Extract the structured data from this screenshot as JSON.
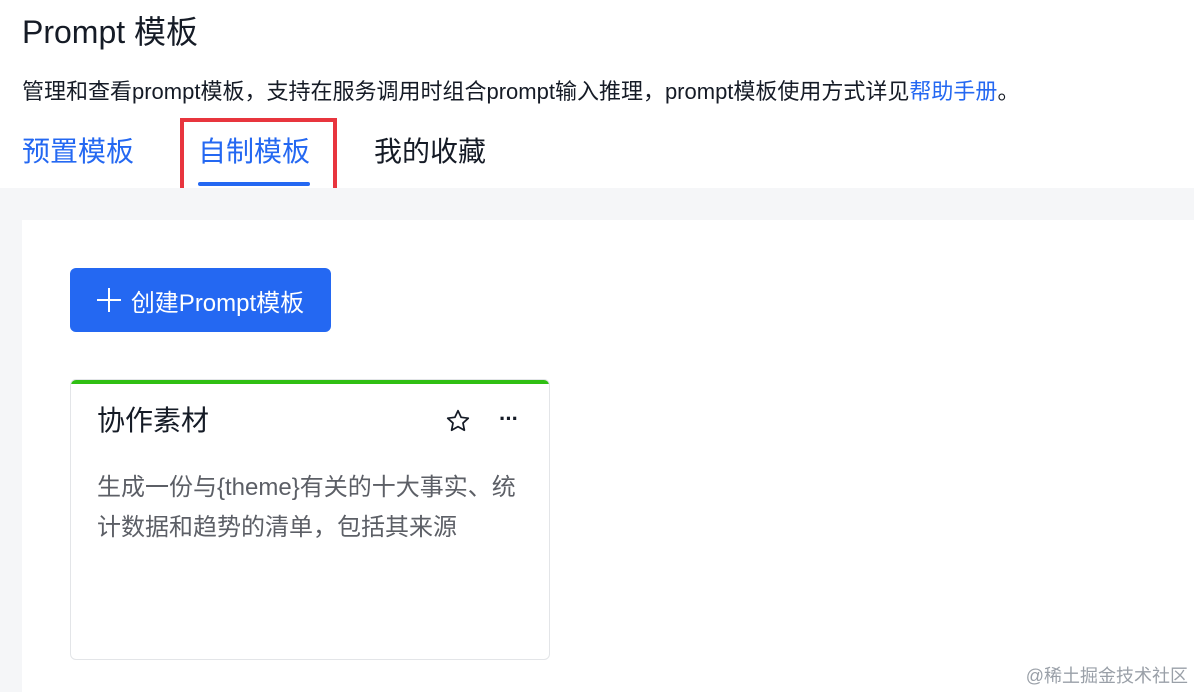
{
  "header": {
    "title": "Prompt 模板",
    "description": "管理和查看prompt模板，支持在服务调用时组合prompt输入推理，prompt模板使用方式详见",
    "help_link": "帮助手册",
    "description_end": "。"
  },
  "tabs": [
    {
      "label": "预置模板"
    },
    {
      "label": "自制模板",
      "active": true
    },
    {
      "label": "我的收藏"
    }
  ],
  "toolbar": {
    "create_label": "创建Prompt模板",
    "create_icon": "plus-icon"
  },
  "cards": [
    {
      "title": "协作素材",
      "description": "生成一份与{theme}有关的十大事实、统计数据和趋势的清单，包括其来源",
      "icons": [
        "star-icon",
        "more-icon"
      ],
      "accent_color": "#30bf13"
    }
  ],
  "watermark": "@稀土掘金技术社区",
  "colors": {
    "primary": "#2468f2",
    "highlight": "#e8353e",
    "card_accent": "#30bf13"
  }
}
